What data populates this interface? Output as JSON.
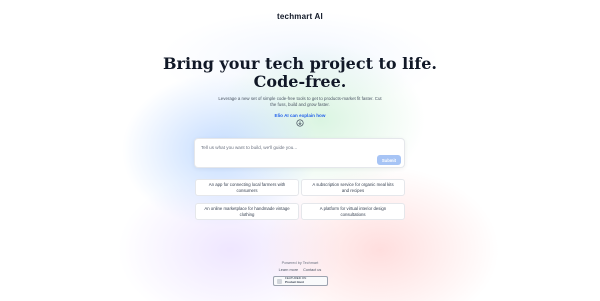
{
  "header": {
    "logo": "techmart AI"
  },
  "hero": {
    "headline_line1": "Bring your tech project to life.",
    "headline_line2": "Code-free.",
    "subtitle": "Leverage a new set of simple code-free tools to get to products-market fit faster. Cut the fuss, build and grow faster.",
    "explain_link": "Elio AI can explain how"
  },
  "prompt": {
    "placeholder": "Tell us what you want to build, we'll guide you...",
    "submit_label": "Submit"
  },
  "suggestions": [
    {
      "label": "An app for connecting local farmers with consumers"
    },
    {
      "label": "A subscription service for organic meal kits and recipes"
    },
    {
      "label": "An online marketplace for handmade vintage clothing"
    },
    {
      "label": "A platform for virtual interior design consultations"
    }
  ],
  "footer": {
    "powered_by": "Powered by Techmart",
    "links": [
      "Learn more",
      "Contact us"
    ],
    "badge_line1": "FEATURED ON",
    "badge_line2": "Product Hunt"
  }
}
